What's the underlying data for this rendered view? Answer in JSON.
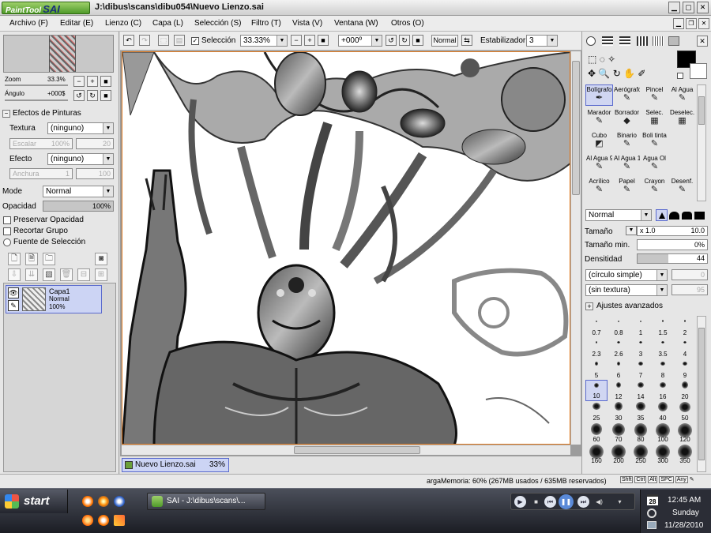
{
  "title": {
    "logo_text": "PaintTool",
    "logo_big": "SAI",
    "window_title": "J:\\dibus\\scans\\dibu054\\Nuevo Lienzo.sai"
  },
  "menu": [
    "Archivo (F)",
    "Editar (E)",
    "Lienzo (C)",
    "Capa (L)",
    "Selección (S)",
    "Filtro (T)",
    "Vista (V)",
    "Ventana (W)",
    "Otros (O)"
  ],
  "navigator": {
    "zoom_label": "Zoom",
    "zoom_value": "33.3%",
    "angle_label": "Ángulo",
    "angle_value": "+000$"
  },
  "effects": {
    "header": "Efectos de Pinturas",
    "texture_label": "Textura",
    "texture_value": "(ninguno)",
    "scale_label": "Escalar",
    "scale_value": "100%",
    "scale_num": "20",
    "effect_label": "Efecto",
    "effect_value": "(ninguno)",
    "width_label": "Anchura",
    "width_value": "1",
    "width_num": "100"
  },
  "layer_props": {
    "mode_label": "Mode",
    "mode_value": "Normal",
    "opacity_label": "Opacidad",
    "opacity_value": "100%",
    "opacity_fraction": 1.0,
    "options": [
      "Preservar Opacidad",
      "Recortar Grupo",
      "Fuente de Selección"
    ]
  },
  "layer": {
    "name": "Capa1",
    "mode": "Normal",
    "opacity": "100%"
  },
  "canvas_toolbar": {
    "selection_label": "Selección",
    "zoom_value": "33.33%",
    "angle_value": "+000º",
    "mode_label": "Normal",
    "stabilizer_label": "Estabilizador",
    "stabilizer_value": "3"
  },
  "doc_tab": {
    "name": "Nuevo Lienzo.sai",
    "zoom": "33%"
  },
  "tools": [
    {
      "label": "Bolígrafo",
      "icon": "pen-icon",
      "glyph": "✒"
    },
    {
      "label": "Aerógrafo",
      "icon": "airbrush-icon",
      "glyph": "✎"
    },
    {
      "label": "Pincel",
      "icon": "brush-icon",
      "glyph": "✎"
    },
    {
      "label": "Al Agua",
      "icon": "watercolor-icon",
      "glyph": "✎"
    },
    {
      "label": "Marador",
      "icon": "marker-icon",
      "glyph": "✎"
    },
    {
      "label": "Borrador",
      "icon": "eraser-icon",
      "glyph": "◆"
    },
    {
      "label": "Selec.",
      "icon": "select-brush-icon",
      "glyph": "▦"
    },
    {
      "label": "Deselec.",
      "icon": "deselect-brush-icon",
      "glyph": "▦"
    },
    {
      "label": "Cubo",
      "icon": "bucket-icon",
      "glyph": "◩"
    },
    {
      "label": "Binario",
      "icon": "binary-pen-icon",
      "glyph": "✎"
    },
    {
      "label": "Boli tinta",
      "icon": "ink-pen-icon",
      "glyph": "✎"
    },
    {
      "label": "",
      "icon": "",
      "glyph": ""
    },
    {
      "label": "Al Agua 9",
      "icon": "watercolor-icon",
      "glyph": "✎"
    },
    {
      "label": "Al Agua 10",
      "icon": "watercolor-icon",
      "glyph": "✎"
    },
    {
      "label": "Agua Ol",
      "icon": "oil-icon",
      "glyph": "✎"
    },
    {
      "label": "",
      "icon": "",
      "glyph": ""
    },
    {
      "label": "Acrílico",
      "icon": "acrylic-icon",
      "glyph": "✎"
    },
    {
      "label": "Papel",
      "icon": "paper-icon",
      "glyph": "✎"
    },
    {
      "label": "Crayon",
      "icon": "crayon-icon",
      "glyph": "✎"
    },
    {
      "label": "Desenf.",
      "icon": "blur-icon",
      "glyph": "✎"
    }
  ],
  "brush_settings": {
    "mode_value": "Normal",
    "size_label": "Tamaño",
    "size_mult": "x 1.0",
    "size_value": "10.0",
    "min_size_label": "Tamaño min.",
    "min_size_value": "0%",
    "density_label": "Densitidad",
    "density_value": "44",
    "density_fraction": 0.44,
    "shape_value": "(círculo simple)",
    "shape_num": "0",
    "texture_value": "(sin textura)",
    "texture_num": "95",
    "advanced_label": "Ajustes avanzados"
  },
  "brush_sizes": [
    "0.7",
    "0.8",
    "1",
    "1.5",
    "2",
    "2.3",
    "2.6",
    "3",
    "3.5",
    "4",
    "5",
    "6",
    "7",
    "8",
    "9",
    "10",
    "12",
    "14",
    "16",
    "20",
    "25",
    "30",
    "35",
    "40",
    "50",
    "60",
    "70",
    "80",
    "100",
    "120",
    "160",
    "200",
    "250",
    "300",
    "350"
  ],
  "selected_brush_size": "10",
  "status": {
    "memory": "argaMemoria: 60% (267MB usados / 635MB reservados)",
    "keys": [
      "Shft",
      "Ctrl",
      "Alt",
      "SPC",
      "Any"
    ]
  },
  "taskbar": {
    "start_label": "start",
    "task_label": "SAI - J:\\dibus\\scans\\...",
    "time": "12:45 AM",
    "day": "Sunday",
    "date": "11/28/2010",
    "calendar_day": "28"
  },
  "colors": {
    "primary": "#000000",
    "secondary": "#ffffff",
    "selection": "#ccd4f4",
    "selection_border": "#5a6acd"
  }
}
